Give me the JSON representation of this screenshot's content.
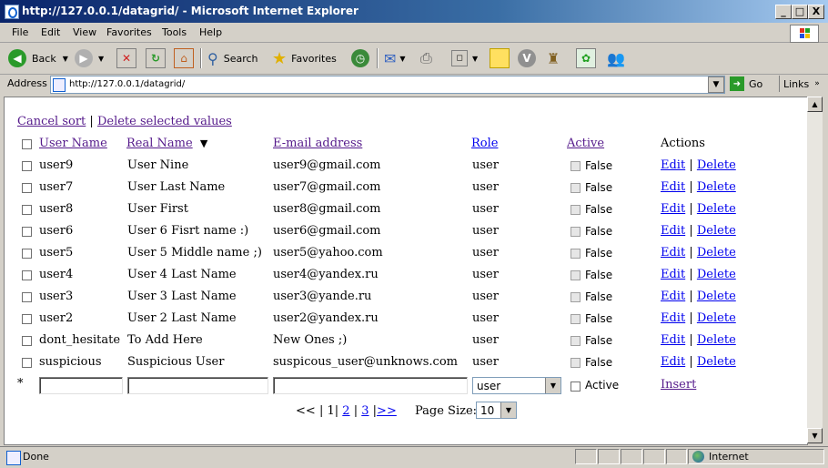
{
  "window": {
    "title": "http://127.0.0.1/datagrid/ - Microsoft Internet Explorer",
    "minimize": "_",
    "maximize": "□",
    "close": "X"
  },
  "menu": [
    "File",
    "Edit",
    "View",
    "Favorites",
    "Tools",
    "Help"
  ],
  "toolbar": {
    "back": "Back",
    "search": "Search",
    "favorites": "Favorites"
  },
  "address": {
    "label": "Address",
    "url": "http://127.0.0.1/datagrid/",
    "go": "Go",
    "links": "Links"
  },
  "grid": {
    "cancel_sort": "Cancel sort",
    "separator": "|",
    "delete_selected": "Delete selected values",
    "headers": {
      "user_name": "User Name",
      "real_name": "Real Name",
      "email": "E-mail address",
      "role": "Role",
      "active": "Active",
      "actions": "Actions"
    },
    "sort_indicator": "real_name-desc",
    "rows": [
      {
        "user": "user9",
        "real": "User Nine",
        "email": "user9@gmail.com",
        "role": "user",
        "active": "False"
      },
      {
        "user": "user7",
        "real": "User Last Name",
        "email": "user7@gmail.com",
        "role": "user",
        "active": "False"
      },
      {
        "user": "user8",
        "real": "User First",
        "email": "user8@gmail.com",
        "role": "user",
        "active": "False"
      },
      {
        "user": "user6",
        "real": "User 6 Fisrt name :)",
        "email": "user6@gmail.com",
        "role": "user",
        "active": "False"
      },
      {
        "user": "user5",
        "real": "User 5 Middle name ;)",
        "email": "user5@yahoo.com",
        "role": "user",
        "active": "False"
      },
      {
        "user": "user4",
        "real": "User 4 Last Name",
        "email": "user4@yandex.ru",
        "role": "user",
        "active": "False"
      },
      {
        "user": "user3",
        "real": "User 3 Last Name",
        "email": "user3@yande.ru",
        "role": "user",
        "active": "False"
      },
      {
        "user": "user2",
        "real": "User 2 Last Name",
        "email": "user2@yandex.ru",
        "role": "user",
        "active": "False"
      },
      {
        "user": "dont_hesitate",
        "real": "To Add Here",
        "email": "New Ones ;)",
        "role": "user",
        "active": "False"
      },
      {
        "user": "suspicious",
        "real": "Suspicious User",
        "email": "suspicous_user@unknows.com",
        "role": "user",
        "active": "False"
      }
    ],
    "row_actions": {
      "edit": "Edit",
      "delete": "Delete"
    },
    "new_row": {
      "marker": "*",
      "role_value": "user",
      "active_label": "Active",
      "insert": "Insert"
    },
    "pager": {
      "first": "<<",
      "sep": "|",
      "current": "1",
      "pages": [
        "2",
        "3"
      ],
      "next": ">>",
      "page_size_label": "Page Size:",
      "page_size": "10"
    }
  },
  "status": {
    "text": "Done",
    "zone": "Internet"
  },
  "colors": {
    "link": "#0000ee",
    "visited": "#551a8b",
    "titlebar": "#0a246a"
  }
}
